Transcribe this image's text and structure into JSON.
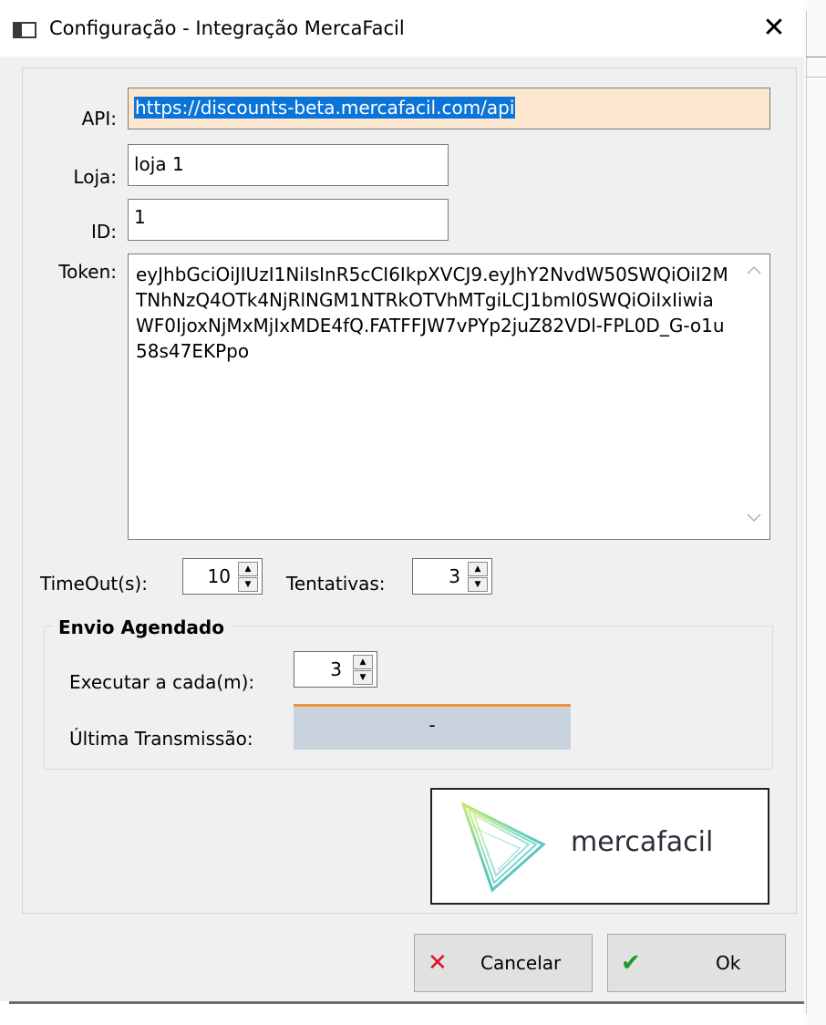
{
  "window": {
    "title": "Configuração - Integração MercaFacil",
    "close_glyph": "✕"
  },
  "form": {
    "api_label": "API:",
    "api_value": "https://discounts-beta.mercafacil.com/api",
    "loja_label": "Loja:",
    "loja_value": "loja 1",
    "id_label": "ID:",
    "id_value": "1",
    "token_label": "Token:",
    "token_value": "eyJhbGciOiJIUzI1NiIsInR5cCI6IkpXVCJ9.eyJhY2NvdW50SWQiOiI2MTNhNzQ4OTk4NjRlNGM1NTRkOTVhMTgiLCJ1bml0SWQiOiIxIiwiaWF0IjoxNjMxMjIxMDE4fQ.FATFFJW7vPYp2juZ82VDl-FPL0D_G-o1u58s47EKPpo",
    "timeout_label": "TimeOut(s):",
    "timeout_value": "10",
    "tentativas_label": "Tentativas:",
    "tentativas_value": "3"
  },
  "envio": {
    "title": "Envio Agendado",
    "executar_label": "Executar a cada(m):",
    "executar_value": "3",
    "ultima_label": "Última Transmissão:",
    "ultima_value": "-"
  },
  "logo": {
    "text": "mercafacil"
  },
  "buttons": {
    "cancel_label": "Cancelar",
    "cancel_icon": "✕",
    "ok_label": "Ok",
    "ok_icon": "✔"
  },
  "icons": {
    "window_icon": "window-icon",
    "spin_up": "▲",
    "spin_down": "▼",
    "scroll_up": "^",
    "scroll_down": "v"
  },
  "colors": {
    "api_highlight": "#fde7d0",
    "selection": "#0a74d8",
    "cancel_red": "#e0102a",
    "ok_green": "#1e9a2a",
    "ultima_bg": "#c9d3dd",
    "ultima_border": "#f0913b"
  }
}
